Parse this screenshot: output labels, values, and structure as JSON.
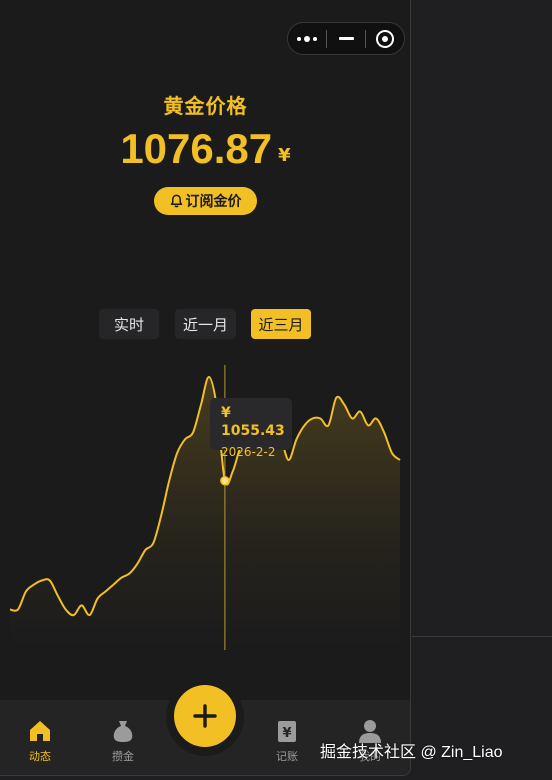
{
  "header": {
    "title": "黄金价格",
    "price": "1076.87",
    "currency": "¥",
    "subscribe_label": "订阅金价"
  },
  "capsule": {
    "menu_icon": "more-dots-icon",
    "minimize_icon": "minus-icon",
    "close_icon": "target-circle-icon"
  },
  "range_tabs": [
    {
      "label": "实时",
      "active": false
    },
    {
      "label": "近一月",
      "active": false
    },
    {
      "label": "近三月",
      "active": true
    }
  ],
  "tooltip": {
    "price": "¥ 1055.43",
    "date": "2026-2-2"
  },
  "chart_data": {
    "type": "area",
    "title": "",
    "xlabel": "",
    "ylabel": "",
    "series": [
      {
        "values": [
          962,
          962,
          975,
          980,
          983,
          983,
          972,
          962,
          958,
          965,
          958,
          970,
          975,
          980,
          985,
          988,
          995,
          1005,
          1010,
          1030,
          1055,
          1075,
          1085,
          1090,
          1110,
          1130,
          1108,
          1055,
          1062,
          1080,
          1085,
          1090,
          1090,
          1080,
          1085,
          1070,
          1085,
          1095,
          1100,
          1100,
          1095,
          1115,
          1110,
          1100,
          1105,
          1095,
          1100,
          1090,
          1075,
          1070
        ]
      }
    ],
    "highlight_index": 27
  },
  "tabbar": {
    "items": [
      {
        "label": "动态",
        "icon": "home-icon",
        "active": true
      },
      {
        "label": "攒金",
        "icon": "money-bag-icon",
        "active": false
      },
      {
        "label": "记账",
        "icon": "ledger-icon",
        "active": false
      },
      {
        "label": "我的",
        "icon": "user-icon",
        "active": false
      }
    ],
    "fab_icon": "plus-icon"
  },
  "watermark": "掘金技术社区 @ Zin_Liao",
  "colors": {
    "accent": "#f2c024",
    "background": "#1b1b1c",
    "tabbar": "#242425"
  }
}
